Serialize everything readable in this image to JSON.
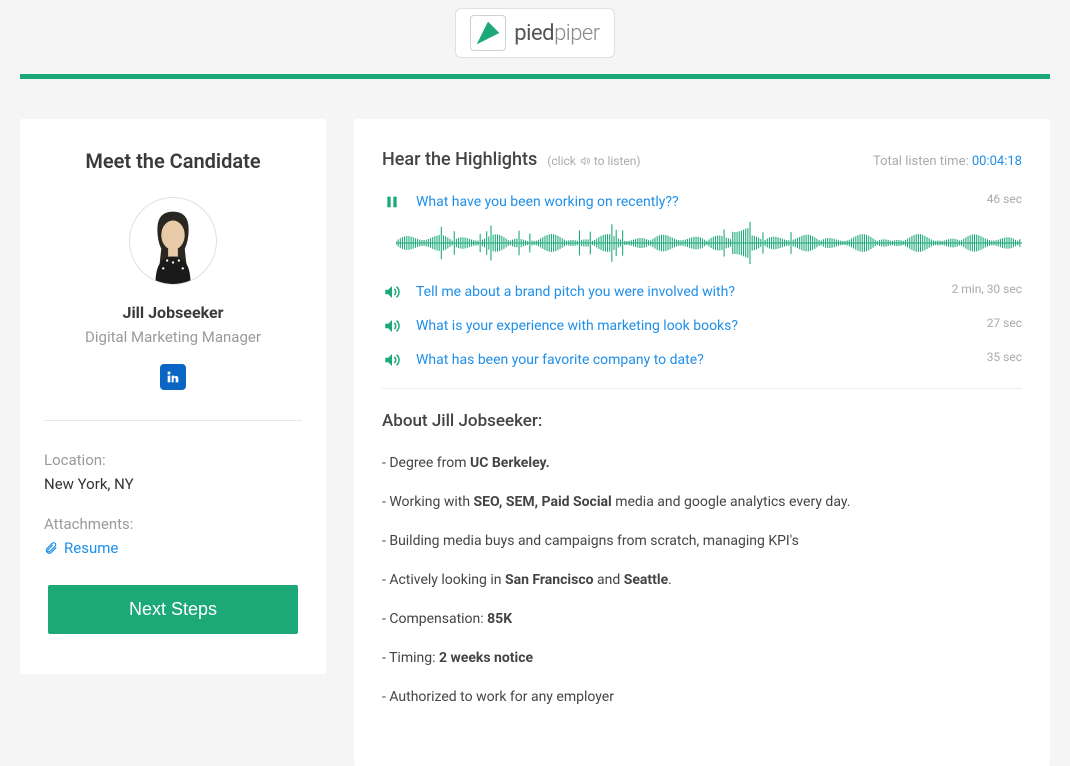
{
  "logo": {
    "brand_a": "pied",
    "brand_b": "piper"
  },
  "sidebar": {
    "title": "Meet the Candidate",
    "name": "Jill Jobseeker",
    "role": "Digital Marketing Manager",
    "location_label": "Location:",
    "location_value": "New York, NY",
    "attach_label": "Attachments:",
    "attach_link": "Resume",
    "next_label": "Next Steps"
  },
  "highlights": {
    "title": "Hear the Highlights",
    "hint_pre": "(click ",
    "hint_post": " to listen)",
    "total_label": "Total listen time: ",
    "total_time": "00:04:18",
    "tracks": [
      {
        "title": "What have you been working on recently??",
        "duration": "46 sec",
        "playing": true
      },
      {
        "title": "Tell me about a brand pitch you were involved with?",
        "duration": "2 min, 30 sec",
        "playing": false
      },
      {
        "title": "What is your experience with marketing look books?",
        "duration": "27 sec",
        "playing": false
      },
      {
        "title": "What has been your favorite company to date?",
        "duration": "35 sec",
        "playing": false
      }
    ]
  },
  "about": {
    "title": "About Jill Jobseeker:",
    "lines": [
      "- Degree from <b>UC Berkeley.</b>",
      "- Working with <b>SEO, SEM, Paid Social</b> media and google analytics every day.",
      "- Building media buys and campaigns from scratch, managing KPI's",
      "- Actively looking in <b>San Francisco</b> and <b>Seattle</b>.",
      "- Compensation: <b>85K</b>",
      "- Timing: <b>2 weeks notice</b>",
      "- Authorized to work for any employer"
    ]
  }
}
